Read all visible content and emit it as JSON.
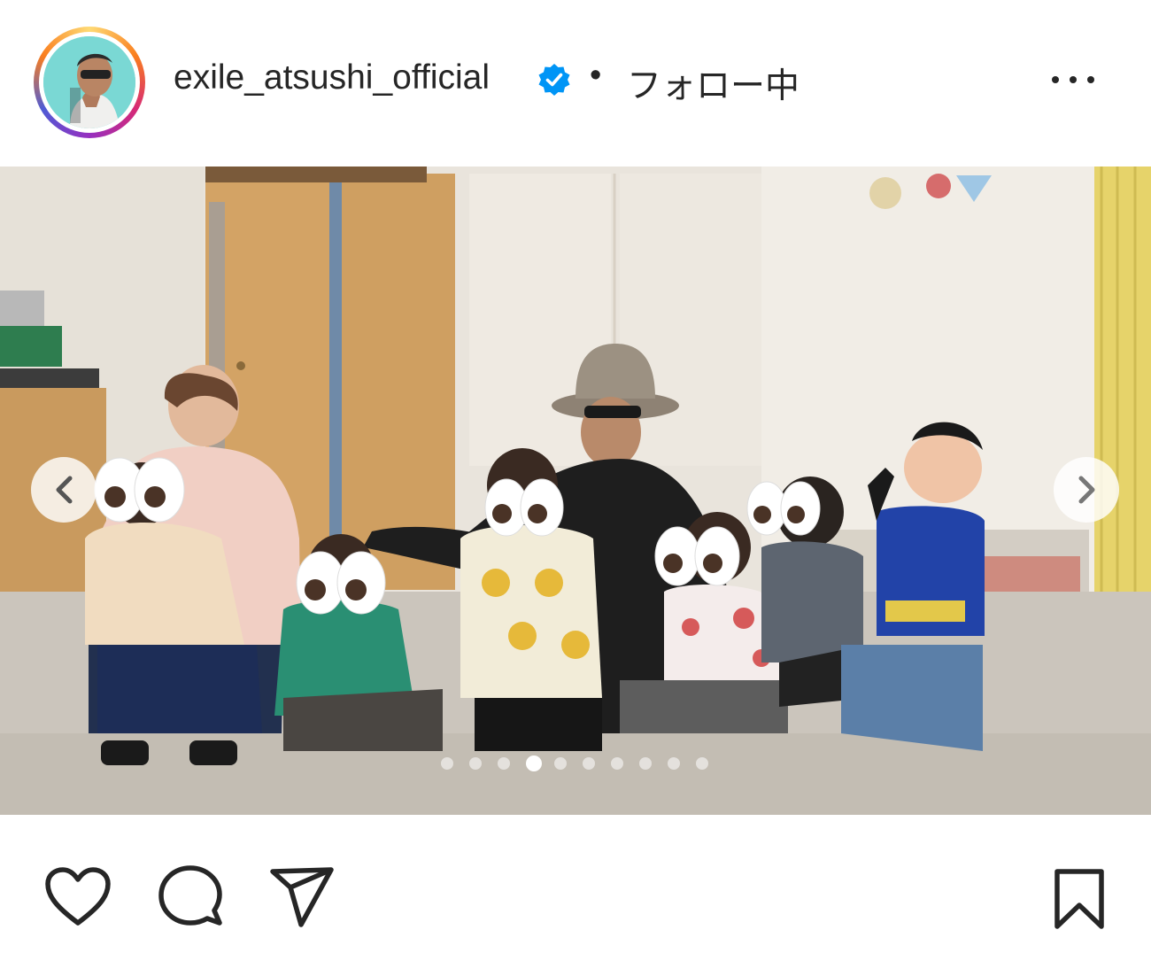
{
  "post": {
    "username": "exile_atsushi_official",
    "verified_icon": "verified-badge-icon",
    "separator": "•",
    "follow_status": "フォロー中",
    "more_icon": "more-options-icon",
    "avatar_icon": "profile-avatar"
  },
  "carousel": {
    "image_description_icon": "post-photo",
    "prev_icon": "chevron-left-icon",
    "next_icon": "chevron-right-icon",
    "total_slides": 10,
    "active_slide": 4
  },
  "actions": {
    "like_icon": "heart-icon",
    "comment_icon": "comment-icon",
    "share_icon": "paper-plane-icon",
    "save_icon": "bookmark-icon"
  },
  "colors": {
    "text": "#262626",
    "verified_blue": "#0095f6",
    "ring_gradient": [
      "#feda75",
      "#fa7e1e",
      "#d62976",
      "#962fbf",
      "#4f5bd5"
    ]
  }
}
